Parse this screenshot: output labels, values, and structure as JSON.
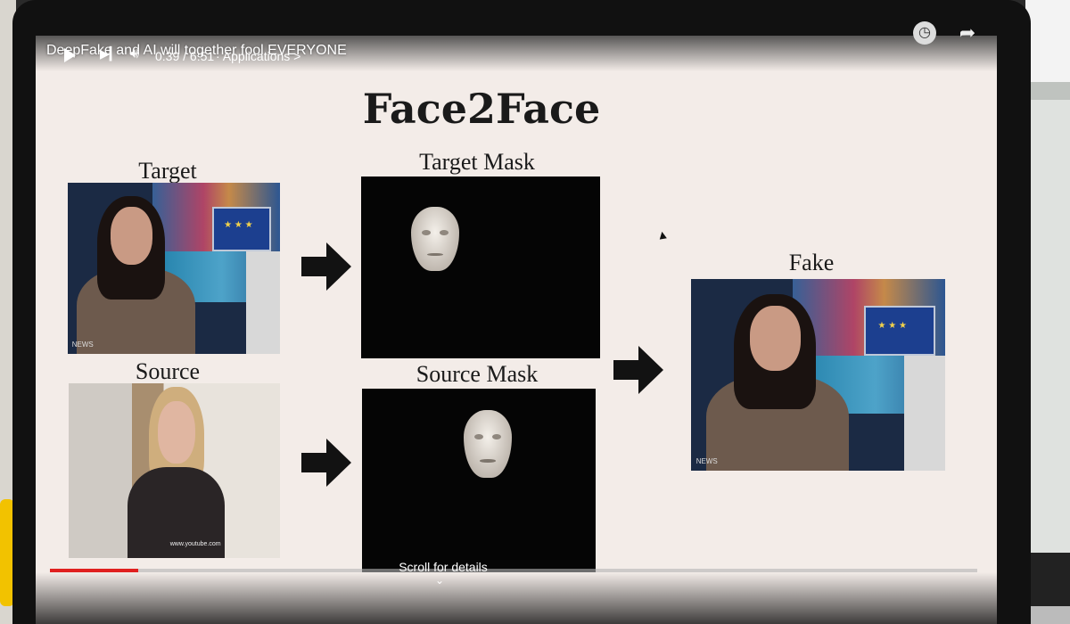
{
  "player": {
    "video_title": "DeepFake and AI will together fool EVERYONE",
    "time_current": "0:39",
    "time_total": "6:51",
    "time_display": "0:39 / 6:51",
    "chapter_label": "· Applications >",
    "scroll_hint": "Scroll for details",
    "progress_fraction": 0.095,
    "accent_color": "#e0201f",
    "icons": [
      "watch-later-icon",
      "share-icon",
      "play-icon",
      "next-icon",
      "volume-icon",
      "chevron-down-icon"
    ]
  },
  "slide": {
    "title": "Face2Face",
    "labels": {
      "target": "Target",
      "source": "Source",
      "target_mask": "Target Mask",
      "source_mask": "Source Mask",
      "fake": "Fake"
    }
  }
}
